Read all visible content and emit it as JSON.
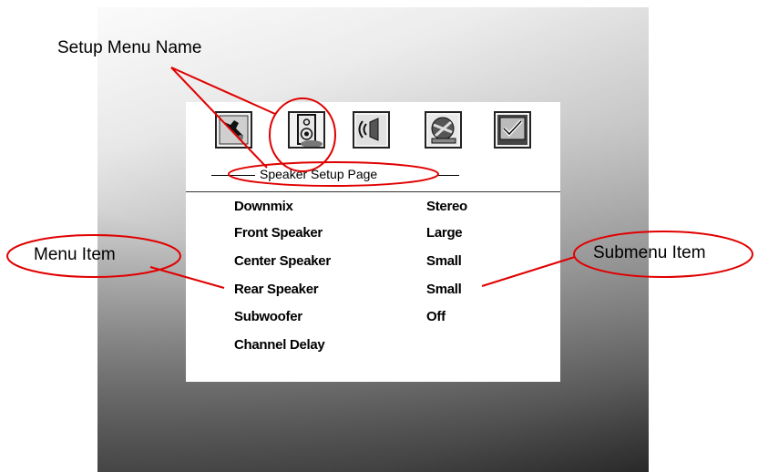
{
  "callouts": {
    "setup_menu_name": "Setup Menu Name",
    "menu_item": "Menu Item",
    "submenu_item": "Submenu Item"
  },
  "menu": {
    "page_title": "Speaker Setup Page",
    "tabs": [
      {
        "icon": "general-setup-icon"
      },
      {
        "icon": "speaker-setup-icon",
        "selected": true
      },
      {
        "icon": "audio-setup-icon"
      },
      {
        "icon": "video-setup-icon"
      },
      {
        "icon": "preference-setup-icon"
      }
    ],
    "items": [
      {
        "label": "Downmix",
        "value": "Stereo"
      },
      {
        "label": "Front Speaker",
        "value": "Large"
      },
      {
        "label": "Center Speaker",
        "value": "Small"
      },
      {
        "label": "Rear Speaker",
        "value": "Small"
      },
      {
        "label": "Subwoofer",
        "value": "Off"
      },
      {
        "label": "Channel Delay",
        "value": ""
      }
    ]
  },
  "colors": {
    "annotation": "#e00000",
    "panel": "#ffffff",
    "text": "#000000"
  }
}
